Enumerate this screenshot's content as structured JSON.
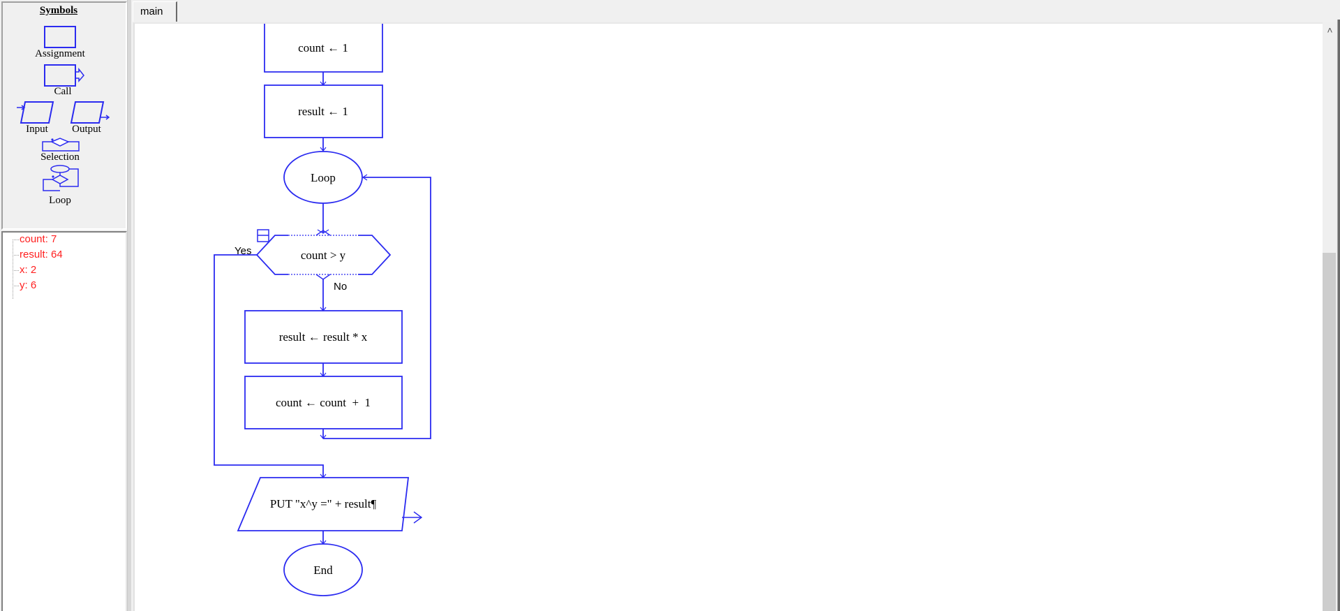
{
  "symbols_panel": {
    "title": "Symbols",
    "items": [
      {
        "label": "Assignment",
        "icon": "assignment-symbol-icon"
      },
      {
        "label": "Call",
        "icon": "call-symbol-icon"
      },
      {
        "label": "Input",
        "icon": "input-symbol-icon"
      },
      {
        "label": "Output",
        "icon": "output-symbol-icon"
      },
      {
        "label": "Selection",
        "icon": "selection-symbol-icon"
      },
      {
        "label": "Loop",
        "icon": "loop-symbol-icon"
      }
    ]
  },
  "watch": {
    "variables": [
      {
        "text": "count: 7",
        "name": "count",
        "value": "7"
      },
      {
        "text": "result: 64",
        "name": "result",
        "value": "64"
      },
      {
        "text": "x: 2",
        "name": "x",
        "value": "2"
      },
      {
        "text": "y: 6",
        "name": "y",
        "value": "6"
      }
    ],
    "color": "#ff2020"
  },
  "tabs": [
    {
      "label": "main",
      "active": true
    }
  ],
  "flowchart": {
    "stroke_color": "#2b2bf0",
    "nodes": {
      "assign_count": "count ← 1",
      "assign_result": "result ← 1",
      "loop": "Loop",
      "condition": "count > y",
      "yes_label": "Yes",
      "no_label": "No",
      "assign_mult": "result ← result * x",
      "assign_incr": "count ← count  +  1",
      "output": "PUT \"x^y =\" + result¶",
      "end": "End"
    }
  },
  "scrollbar": {
    "up_arrow": "˄"
  }
}
